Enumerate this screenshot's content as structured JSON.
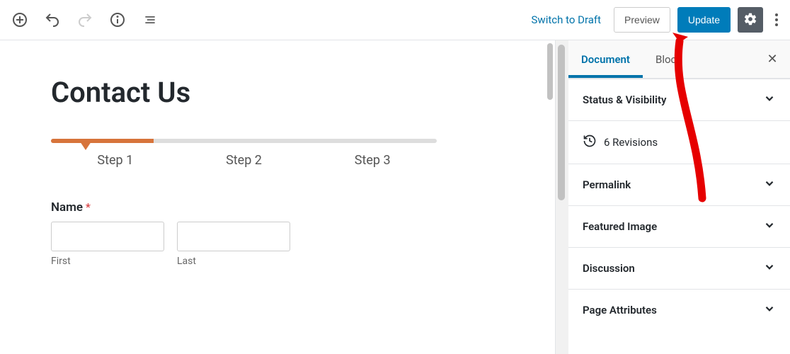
{
  "toolbar": {
    "switch_to_draft": "Switch to Draft",
    "preview": "Preview",
    "update": "Update"
  },
  "page": {
    "title": "Contact Us"
  },
  "form": {
    "steps": [
      "Step 1",
      "Step 2",
      "Step 3"
    ],
    "active_step_index": 0,
    "name_label": "Name",
    "required_mark": "*",
    "first_label": "First",
    "last_label": "Last"
  },
  "sidebar": {
    "tabs": {
      "document": "Document",
      "block": "Block"
    },
    "active_tab": "document",
    "panels": {
      "status": "Status & Visibility",
      "revisions_count": "6 Revisions",
      "permalink": "Permalink",
      "featured_image": "Featured Image",
      "discussion": "Discussion",
      "page_attributes": "Page Attributes"
    }
  },
  "colors": {
    "accent": "#007cba",
    "progress": "#d7743b"
  }
}
